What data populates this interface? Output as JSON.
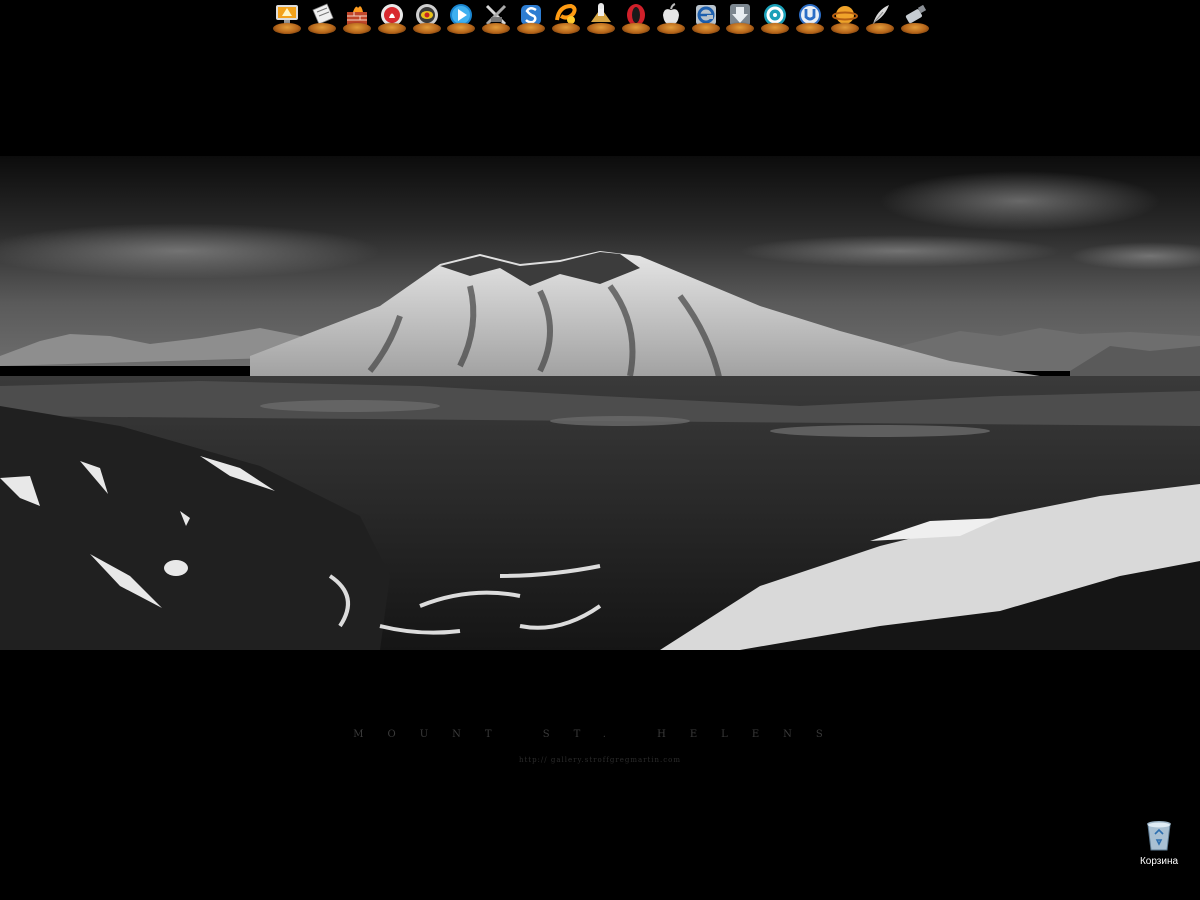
{
  "dock": {
    "items": [
      {
        "name": "my-computer",
        "icon": "monitor-icon"
      },
      {
        "name": "documents",
        "icon": "notepad-icon"
      },
      {
        "name": "firewall",
        "icon": "fire-wall-icon"
      },
      {
        "name": "sound-player",
        "icon": "red-disc-icon"
      },
      {
        "name": "media-player",
        "icon": "eye-disc-icon"
      },
      {
        "name": "play-media",
        "icon": "blue-play-icon"
      },
      {
        "name": "tools",
        "icon": "crossed-tools-icon"
      },
      {
        "name": "messenger",
        "icon": "blue-s-icon"
      },
      {
        "name": "paint",
        "icon": "orange-swirl-icon"
      },
      {
        "name": "chess-game",
        "icon": "chess-icon"
      },
      {
        "name": "opera-browser",
        "icon": "opera-icon"
      },
      {
        "name": "apple",
        "icon": "apple-icon"
      },
      {
        "name": "internet-explorer",
        "icon": "internet-explorer-icon"
      },
      {
        "name": "downloads",
        "icon": "download-arrow-icon"
      },
      {
        "name": "network",
        "icon": "spiral-icon"
      },
      {
        "name": "torrent",
        "icon": "utorrent-icon"
      },
      {
        "name": "world",
        "icon": "planet-icon"
      },
      {
        "name": "graphics",
        "icon": "feather-pen-icon"
      },
      {
        "name": "usb-drive",
        "icon": "usb-stick-icon"
      }
    ]
  },
  "wallpaper": {
    "caption": "MOUNT ST. HELENS",
    "url": "http:// gallery.stroffgregmartin.com"
  },
  "desktop": {
    "recycle_bin_label": "Корзина"
  },
  "colors": {
    "background": "#000000",
    "dock_base": "#c9741f"
  }
}
